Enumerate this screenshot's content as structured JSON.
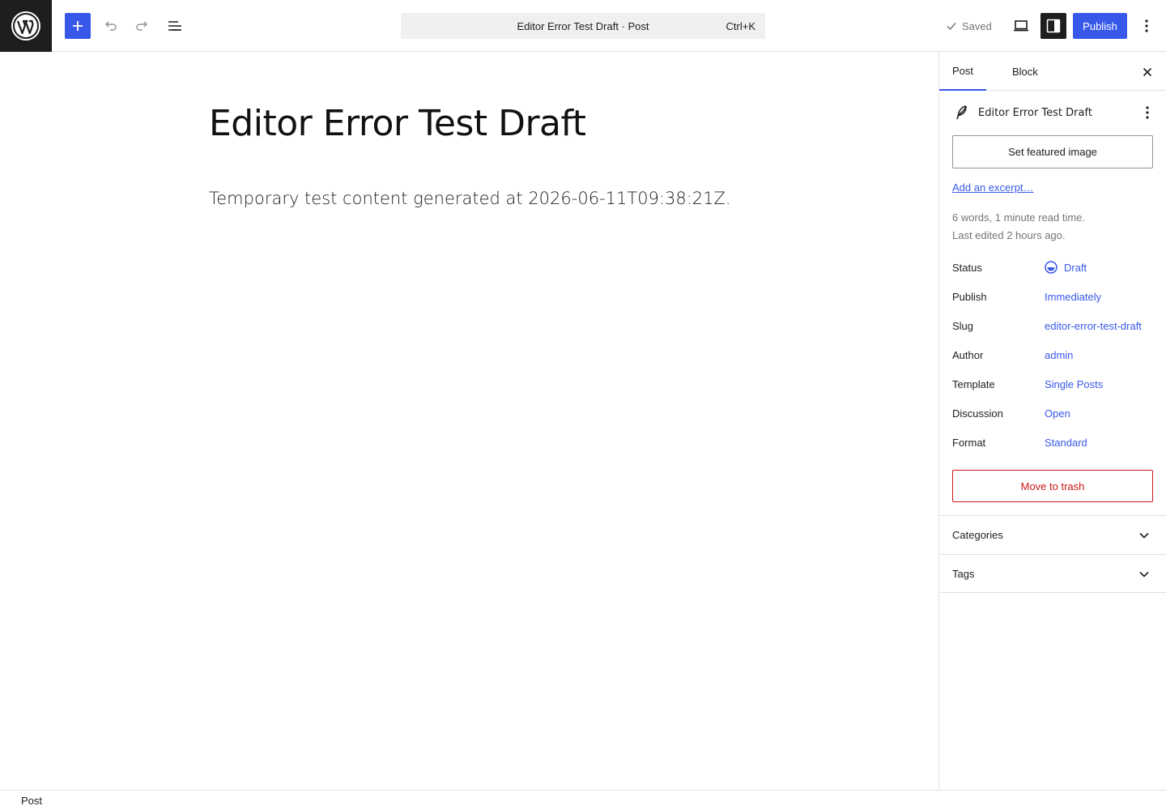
{
  "header": {
    "logo_icon": "wordpress-logo-icon",
    "command_bar_title": "Editor Error Test Draft · Post",
    "command_bar_shortcut": "Ctrl+K",
    "saved_label": "Saved",
    "publish_label": "Publish",
    "accent_color": "#3858e9"
  },
  "editor": {
    "title": "Editor Error Test Draft",
    "paragraph": "Temporary test content generated at 2026-06-11T09:38:21Z."
  },
  "sidebar": {
    "tabs": [
      {
        "label": "Post"
      },
      {
        "label": "Block"
      }
    ],
    "post_name": "Editor Error Test Draft",
    "featured_image_label": "Set featured image",
    "excerpt_link": "Add an excerpt…",
    "word_info": "6 words, 1 minute read time.",
    "last_edited": "Last edited 2 hours ago.",
    "rows": [
      {
        "label": "Status",
        "value": "Draft"
      },
      {
        "label": "Publish",
        "value": "Immediately"
      },
      {
        "label": "Slug",
        "value": "editor-error-test-draft"
      },
      {
        "label": "Author",
        "value": "admin"
      },
      {
        "label": "Template",
        "value": "Single Posts"
      },
      {
        "label": "Discussion",
        "value": "Open"
      },
      {
        "label": "Format",
        "value": "Standard"
      }
    ],
    "trash_label": "Move to trash",
    "panels": [
      {
        "label": "Categories"
      },
      {
        "label": "Tags"
      }
    ],
    "danger_color": "#cc1818"
  },
  "footer": {
    "breadcrumb": "Post"
  }
}
